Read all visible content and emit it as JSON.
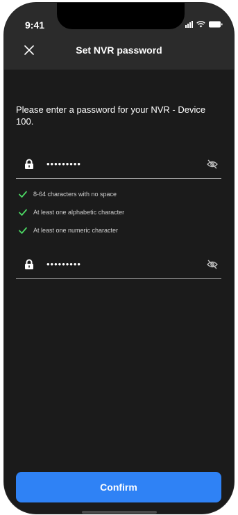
{
  "status_bar": {
    "time": "9:41"
  },
  "header": {
    "title": "Set NVR password"
  },
  "prompt": "Please enter a password for your NVR - Device 100.",
  "password_field": {
    "masked_value": "•••••••••"
  },
  "confirm_field": {
    "masked_value": "•••••••••"
  },
  "rules": [
    {
      "label": "8-64 characters with no space",
      "status": "met"
    },
    {
      "label": "At least one alphabetic character",
      "status": "met"
    },
    {
      "label": "At least one numeric character",
      "status": "met"
    }
  ],
  "confirm_button": {
    "label": "Confirm"
  },
  "colors": {
    "accent": "#2f82f5",
    "check": "#4cd964",
    "background": "#1b1b1b",
    "header": "#2b2b2b"
  }
}
